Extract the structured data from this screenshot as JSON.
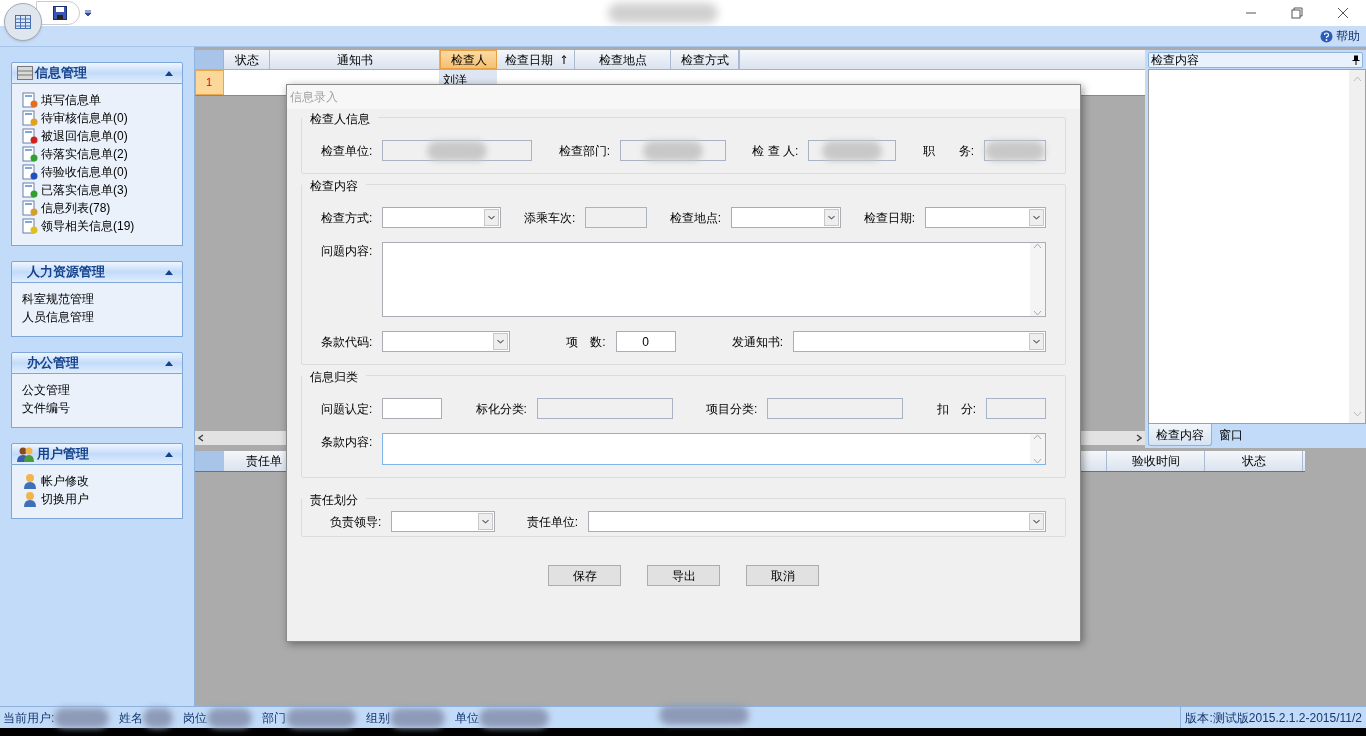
{
  "toolbar": {
    "help": "帮助"
  },
  "sidebar": {
    "groups": [
      {
        "title": "信息管理",
        "expanded": true,
        "kind": "icons",
        "items": [
          {
            "label": "填写信息单"
          },
          {
            "label": "待审核信息单(0)"
          },
          {
            "label": "被退回信息单(0)"
          },
          {
            "label": "待落实信息单(2)"
          },
          {
            "label": "待验收信息单(0)"
          },
          {
            "label": "已落实信息单(3)"
          },
          {
            "label": "信息列表(78)"
          },
          {
            "label": "领导相关信息(19)"
          }
        ]
      },
      {
        "title": "人力资源管理",
        "expanded": true,
        "kind": "plain",
        "items": [
          {
            "label": "科室规范管理"
          },
          {
            "label": "人员信息管理"
          }
        ]
      },
      {
        "title": "办公管理",
        "expanded": true,
        "kind": "plain",
        "items": [
          {
            "label": "公文管理"
          },
          {
            "label": "文件编号"
          }
        ]
      },
      {
        "title": "用户管理",
        "expanded": true,
        "kind": "icons",
        "items": [
          {
            "label": "帐户修改"
          },
          {
            "label": "切换用户"
          }
        ]
      }
    ]
  },
  "grid": {
    "columns": [
      {
        "label": "状态",
        "selected": false,
        "sorted": false
      },
      {
        "label": "通知书",
        "selected": false,
        "sorted": false
      },
      {
        "label": "检查人",
        "selected": true,
        "sorted": false
      },
      {
        "label": "检查日期",
        "selected": false,
        "sorted": true
      },
      {
        "label": "检查地点",
        "selected": false,
        "sorted": false
      },
      {
        "label": "检查方式",
        "selected": false,
        "sorted": false
      }
    ],
    "rows": [
      {
        "header": "1",
        "selected": true,
        "inspector": "刘洋"
      }
    ]
  },
  "side_panel": {
    "title": "检查内容",
    "tabs": [
      {
        "label": "检查内容",
        "selected": true
      },
      {
        "label": "窗口",
        "selected": false
      }
    ]
  },
  "lower_grid": {
    "columns": [
      "责任单",
      "验收时间",
      "状态"
    ]
  },
  "dialog": {
    "title": "信息录入",
    "sections": [
      {
        "title": "检查人信息",
        "rows": [
          [
            {
              "label": "检查单位:",
              "kind": "readonly",
              "redacted": true
            },
            {
              "label": "检查部门:",
              "kind": "readonly",
              "redacted": true
            },
            {
              "label": "检 查 人:",
              "kind": "readonly",
              "redacted": true
            },
            {
              "label": "职　　务:",
              "kind": "readonly",
              "redacted": true
            }
          ]
        ]
      },
      {
        "title": "检查内容",
        "rows": [
          [
            {
              "label": "检查方式:",
              "kind": "combo"
            },
            {
              "label": "添乘车次:",
              "kind": "readonly"
            },
            {
              "label": "检查地点:",
              "kind": "combo"
            },
            {
              "label": "检查日期:",
              "kind": "combo"
            }
          ],
          [
            {
              "label": "问题内容:",
              "kind": "textarea"
            }
          ],
          [
            {
              "label": "条款代码:",
              "kind": "combo"
            },
            {
              "label": "项　数:",
              "kind": "text",
              "value": "0"
            },
            {
              "label": "发通知书:",
              "kind": "combo"
            }
          ]
        ]
      },
      {
        "title": "信息归类",
        "rows": [
          [
            {
              "label": "问题认定:",
              "kind": "text"
            },
            {
              "label": "标化分类:",
              "kind": "readonly"
            },
            {
              "label": "项目分类:",
              "kind": "readonly"
            },
            {
              "label": "扣　分:",
              "kind": "readonly"
            }
          ],
          [
            {
              "label": "条款内容:",
              "kind": "textarea",
              "focused": true
            }
          ]
        ]
      },
      {
        "title": "责任划分",
        "rows": [
          [
            {
              "label": "负责领导:",
              "kind": "combo"
            },
            {
              "label": "责任单位:",
              "kind": "combo"
            }
          ]
        ]
      }
    ],
    "buttons": [
      "保存",
      "导出",
      "取消"
    ]
  },
  "status_bar": {
    "fields": [
      "当前用户:",
      "姓名",
      "岗位",
      "部门",
      "组别",
      "单位"
    ],
    "version": "版本:测试版2015.2.1.2-2015/11/2"
  }
}
